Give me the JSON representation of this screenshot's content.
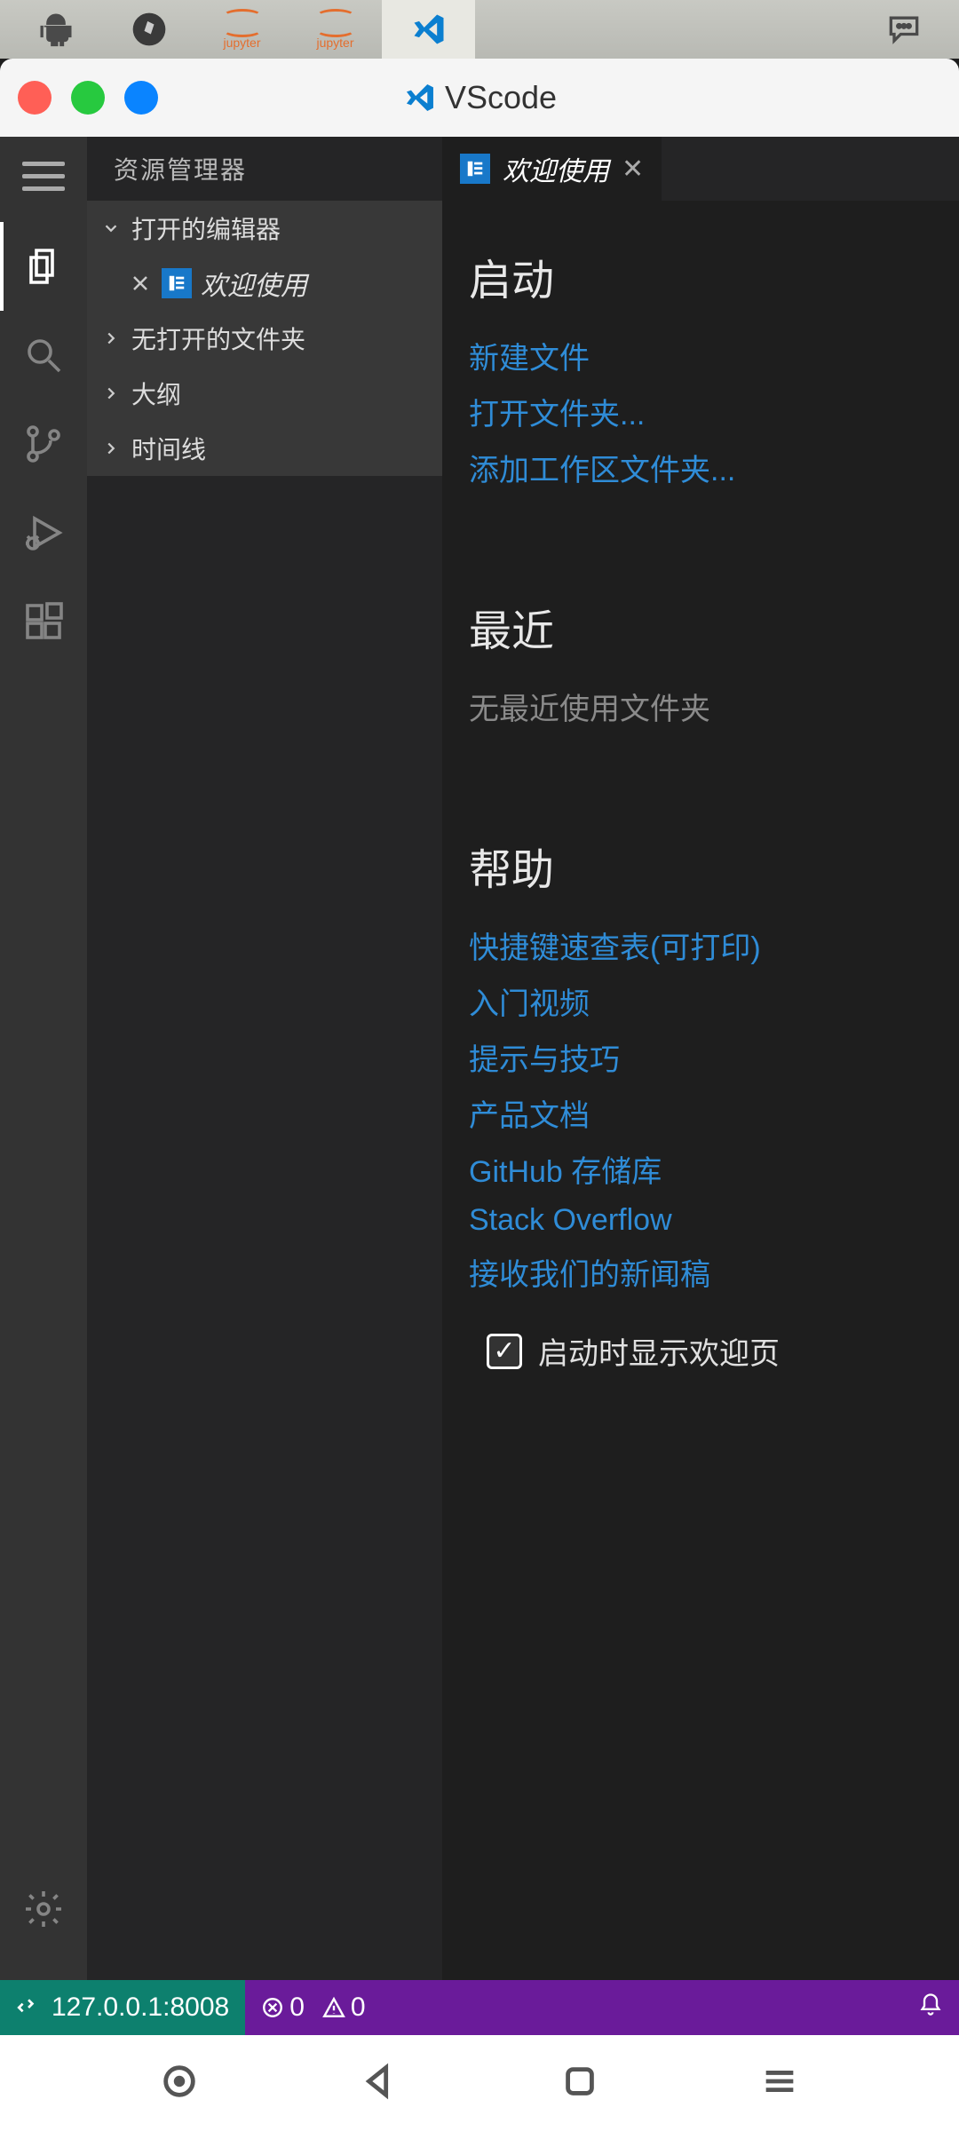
{
  "taskbar": {
    "items": [
      "android",
      "compass",
      "jupyter",
      "jupyter",
      "vscode"
    ],
    "right_icon": "chat"
  },
  "window": {
    "title": "VScode"
  },
  "sidebar": {
    "title": "资源管理器",
    "sections": {
      "open_editors": "打开的编辑器",
      "open_file": "欢迎使用",
      "no_folder": "无打开的文件夹",
      "outline": "大纲",
      "timeline": "时间线"
    }
  },
  "tab": {
    "label": "欢迎使用"
  },
  "welcome": {
    "start": {
      "title": "启动",
      "links": [
        "新建文件",
        "打开文件夹...",
        "添加工作区文件夹..."
      ]
    },
    "recent": {
      "title": "最近",
      "empty": "无最近使用文件夹"
    },
    "help": {
      "title": "帮助",
      "links": [
        "快捷键速查表(可打印)",
        "入门视频",
        "提示与技巧",
        "产品文档",
        "GitHub 存储库",
        "Stack Overflow",
        "接收我们的新闻稿"
      ]
    },
    "show_on_startup": "启动时显示欢迎页"
  },
  "status": {
    "remote": "127.0.0.1:8008",
    "errors": "0",
    "warnings": "0"
  }
}
